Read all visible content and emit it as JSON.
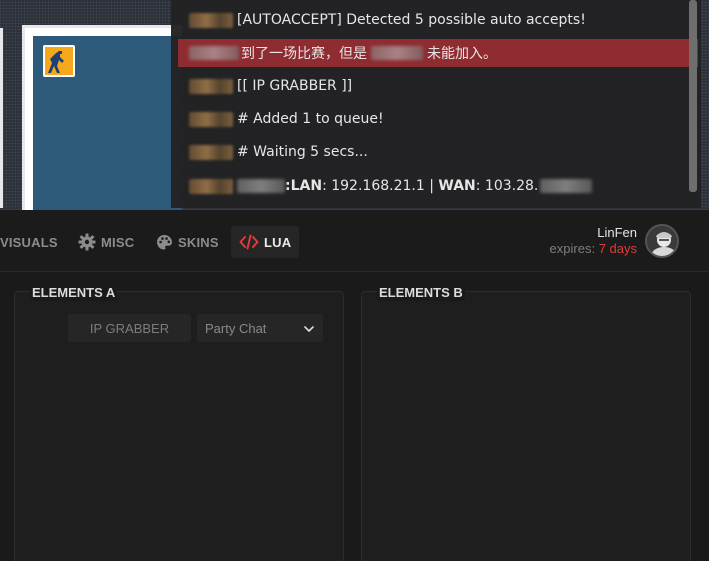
{
  "chat": {
    "lines": [
      {
        "text": "[AUTOACCEPT] Detected 5 possible auto accepts!"
      },
      {
        "text_before": "到了一场比赛，但是",
        "text_after": "未能加入。"
      },
      {
        "text": "[[ IP GRABBER ]]"
      },
      {
        "text": "# Added 1 to queue!"
      },
      {
        "text": "# Waiting 5 secs..."
      },
      {
        "lan_label": ":LAN",
        "lan_value": ": 192.168.21.1 | ",
        "wan_label": "WAN",
        "wan_value": ": 103.28."
      }
    ]
  },
  "nav": {
    "tabs": [
      {
        "label": "VISUALS",
        "icon": "eye-icon"
      },
      {
        "label": "MISC",
        "icon": "gear-icon"
      },
      {
        "label": "SKINS",
        "icon": "palette-icon"
      },
      {
        "label": "LUA",
        "icon": "code-icon",
        "active": true
      }
    ]
  },
  "user": {
    "name": "LinFen",
    "expires_label": "expires:",
    "expires_value": "7 days"
  },
  "panels": {
    "a": {
      "title": "ELEMENTS A",
      "button_label": "IP GRABBER",
      "dropdown_value": "Party Chat"
    },
    "b": {
      "title": "ELEMENTS B"
    }
  },
  "colors": {
    "accent": "#e23a3a",
    "highlight_row": "#8e2c31",
    "background": "#1a1a1a"
  }
}
